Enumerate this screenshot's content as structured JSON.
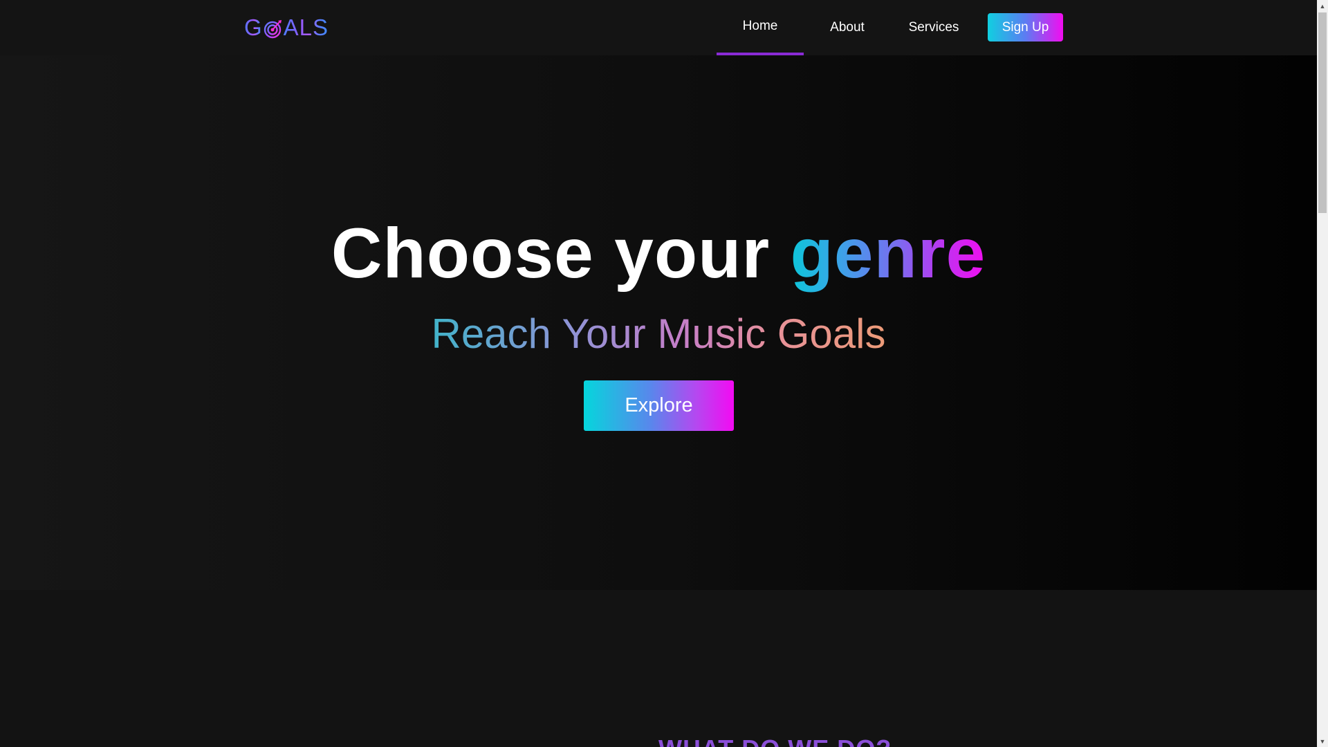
{
  "logo": {
    "text_start": "G",
    "text_end": "ALS",
    "icon": "target-icon"
  },
  "nav": {
    "items": [
      {
        "label": "Home",
        "active": true
      },
      {
        "label": "About",
        "active": false
      },
      {
        "label": "Services",
        "active": false
      }
    ],
    "signup_label": "Sign Up"
  },
  "hero": {
    "headline_plain": "Choose your ",
    "headline_accent": "genre",
    "subline": "Reach Your Music Goals",
    "cta_label": "Explore"
  },
  "section2": {
    "title": "WHAT DO WE DO?"
  },
  "colors": {
    "accent_purple": "#8a2bd6",
    "gradient_cyan": "#0dc6d9",
    "gradient_magenta": "#f00ef0",
    "background": "#131313"
  },
  "scrollbar": {
    "up_icon": "chevron-up-icon",
    "down_icon": "chevron-down-icon"
  }
}
